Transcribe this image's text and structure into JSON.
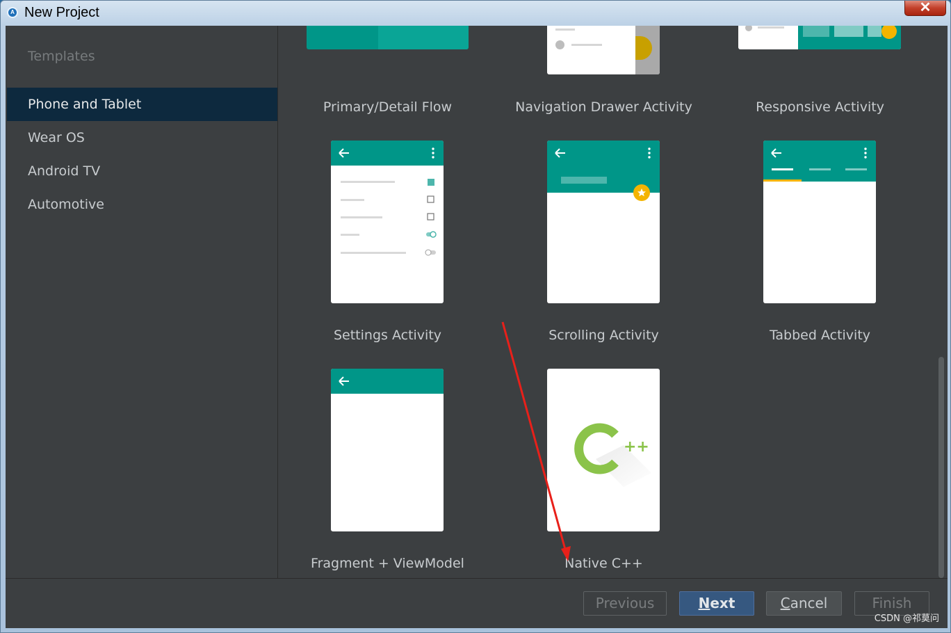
{
  "window": {
    "title": "New Project",
    "close_glyph": "✕"
  },
  "sidebar": {
    "header": "Templates",
    "items": [
      {
        "label": "Phone and Tablet",
        "selected": true
      },
      {
        "label": "Wear OS"
      },
      {
        "label": "Android TV"
      },
      {
        "label": "Automotive"
      }
    ]
  },
  "templates": [
    {
      "label": "Primary/Detail Flow"
    },
    {
      "label": "Navigation Drawer Activity"
    },
    {
      "label": "Responsive Activity"
    },
    {
      "label": "Settings Activity"
    },
    {
      "label": "Scrolling Activity"
    },
    {
      "label": "Tabbed Activity"
    },
    {
      "label": "Fragment + ViewModel"
    },
    {
      "label": "Native C++",
      "cpp_mark": "++"
    }
  ],
  "footer": {
    "previous": "Previous",
    "next": {
      "first": "N",
      "rest": "ext"
    },
    "cancel": {
      "first": "C",
      "rest": "ancel"
    },
    "finish": "Finish"
  },
  "watermark": "CSDN @祁莫问",
  "colors": {
    "teal": "#009688",
    "accent": "#f4b400",
    "arrow": "#e8201a"
  }
}
